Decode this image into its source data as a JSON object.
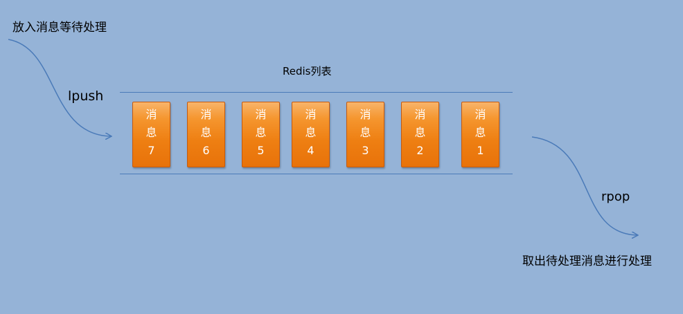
{
  "labels": {
    "push_description": "放入消息等待处理",
    "push_command": "lpush",
    "list_name": "Redis列表",
    "pop_command": "rpop",
    "pop_description": "取出待处理消息进行处理"
  },
  "messages": [
    {
      "top": "消",
      "bottom": "息",
      "number": "7"
    },
    {
      "top": "消",
      "bottom": "息",
      "number": "6"
    },
    {
      "top": "消",
      "bottom": "息",
      "number": "5"
    },
    {
      "top": "消",
      "bottom": "息",
      "number": "4"
    },
    {
      "top": "消",
      "bottom": "息",
      "number": "3"
    },
    {
      "top": "消",
      "bottom": "息",
      "number": "2"
    },
    {
      "top": "消",
      "bottom": "息",
      "number": "1"
    }
  ],
  "colors": {
    "background": "#95b3d7",
    "message_box": "#ee7f12",
    "arrow": "#4a7ab8"
  }
}
